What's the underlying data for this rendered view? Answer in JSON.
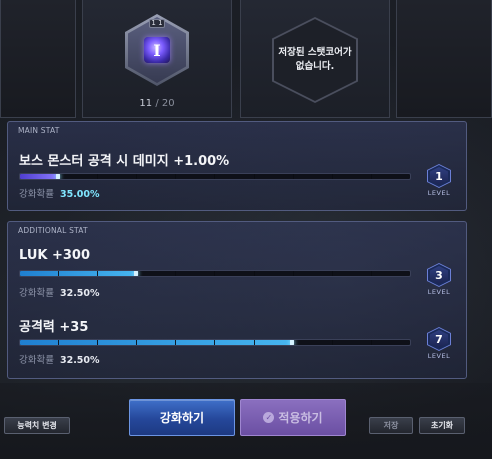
{
  "core": {
    "level_tag": "1 1",
    "icon_letter": "I",
    "count_current": "11",
    "count_total": "/ 20"
  },
  "empty_core": {
    "message": "저장된 스탯코어가\n없습니다."
  },
  "main_stat": {
    "section_label": "MAIN STAT",
    "name": "보스 몬스터 공격 시 데미지 +1.00%",
    "prob_label": "강화확률",
    "prob_value": "35.00%",
    "level": "1",
    "level_label": "LEVEL",
    "progress": 0.1
  },
  "additional_stat": {
    "section_label": "ADDITIONAL STAT",
    "stats": [
      {
        "name": "LUK +300",
        "prob_label": "강화확률",
        "prob_value": "32.50%",
        "level": "3",
        "level_label": "LEVEL",
        "progress": 0.3
      },
      {
        "name": "공격력 +35",
        "prob_label": "강화확률",
        "prob_value": "32.50%",
        "level": "7",
        "level_label": "LEVEL",
        "progress": 0.7
      }
    ]
  },
  "buttons": {
    "stat_change": "능력치 변경",
    "enhance": "강화하기",
    "apply": "적용하기",
    "save": "저장",
    "reset": "초기화"
  },
  "colors": {
    "main_bar": "#8b7cff",
    "add_bar": "#47b6f0",
    "enhance_button": "#2a4fa3",
    "apply_button": "#7a5fb3"
  }
}
